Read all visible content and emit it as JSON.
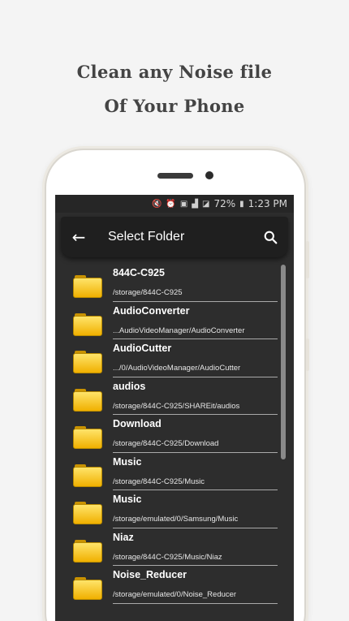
{
  "headline": {
    "line1": "Clean any Noise file",
    "line2": "Of Your Phone"
  },
  "status": {
    "battery": "72%",
    "time": "1:23 PM"
  },
  "appbar": {
    "title": "Select Folder"
  },
  "folders": [
    {
      "name": "844C-C925",
      "path": "/storage/844C-C925"
    },
    {
      "name": "AudioConverter",
      "path": "...AudioVideoManager/AudioConverter"
    },
    {
      "name": "AudioCutter",
      "path": ".../0/AudioVideoManager/AudioCutter"
    },
    {
      "name": "audios",
      "path": "/storage/844C-C925/SHAREit/audios"
    },
    {
      "name": "Download",
      "path": "/storage/844C-C925/Download"
    },
    {
      "name": "Music",
      "path": "/storage/844C-C925/Music"
    },
    {
      "name": "Music",
      "path": "/storage/emulated/0/Samsung/Music"
    },
    {
      "name": "Niaz",
      "path": "/storage/844C-C925/Music/Niaz"
    },
    {
      "name": "Noise_Reducer",
      "path": "/storage/emulated/0/Noise_Reducer"
    }
  ],
  "icons": {
    "back": "arrow-left-icon",
    "search": "search-icon",
    "folder": "folder-icon"
  }
}
